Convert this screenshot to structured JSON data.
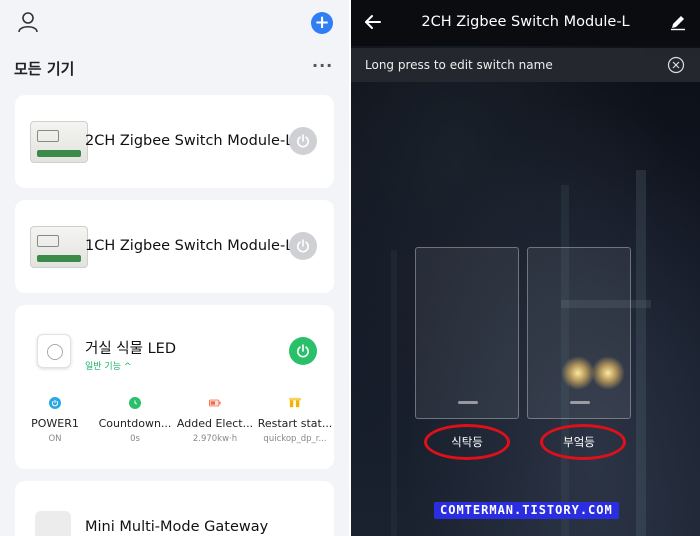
{
  "left": {
    "section_title": "모든 기기",
    "more_label": "···",
    "add_label": "+",
    "devices": [
      {
        "name": "2CH Zigbee Switch Module-L",
        "power": "off"
      },
      {
        "name": "1CH Zigbee Switch Module-L",
        "power": "off"
      },
      {
        "name": "거실 식물 LED",
        "power": "on",
        "subtitle": "일반 기능 ^",
        "functions": [
          {
            "label": "POWER1",
            "value": "ON",
            "icon": "power-icon",
            "color": "#29a8e6"
          },
          {
            "label": "Countdown...",
            "value": "0s",
            "icon": "clock-icon",
            "color": "#2ac06a"
          },
          {
            "label": "Added Elect...",
            "value": "2.970kw·h",
            "icon": "battery-icon",
            "color": "#f26b4a"
          },
          {
            "label": "Restart stat...",
            "value": "quickop_dp_r...",
            "icon": "restart-icon",
            "color": "#f2b400"
          }
        ]
      },
      {
        "name": "Mini Multi-Mode Gateway"
      }
    ]
  },
  "right": {
    "title": "2CH Zigbee Switch Module-L",
    "notice": "Long press to edit switch name",
    "switches": [
      {
        "label": "식탁등"
      },
      {
        "label": "부엌등"
      }
    ],
    "watermark": "COMTERMAN.TISTORY.COM"
  }
}
